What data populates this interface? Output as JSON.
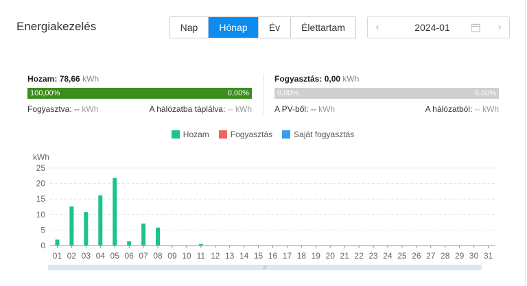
{
  "header": {
    "title": "Energiakezelés",
    "tabs": [
      {
        "label": "Nap",
        "active": false
      },
      {
        "label": "Hónap",
        "active": true
      },
      {
        "label": "Év",
        "active": false
      },
      {
        "label": "Élettartam",
        "active": false
      }
    ],
    "date_value": "2024-01"
  },
  "yield": {
    "label": "Hozam:",
    "value": "78,66",
    "unit": "kWh",
    "bar_left": "100,00%",
    "bar_right": "0,00%",
    "consumed_label": "Fogyasztva:",
    "consumed_value": "--",
    "consumed_unit": "kWh",
    "grid_label": "A hálózatba táplálva:",
    "grid_value": "--",
    "grid_unit": "kWh"
  },
  "consumption": {
    "label": "Fogyasztás:",
    "value": "0,00",
    "unit": "kWh",
    "bar_left": "0,00%",
    "bar_right": "0,00%",
    "pv_label": "A PV-ből:",
    "pv_value": "--",
    "pv_unit": "kWh",
    "grid_label": "A hálózatból:",
    "grid_value": "--",
    "grid_unit": "kWh"
  },
  "legend": [
    {
      "label": "Hozam",
      "color": "#1dc48a"
    },
    {
      "label": "Fogyasztás",
      "color": "#f0645a"
    },
    {
      "label": "Saját fogyasztás",
      "color": "#3c9af0"
    }
  ],
  "chart_data": {
    "type": "bar",
    "ylabel": "kWh",
    "ylim": [
      0,
      25
    ],
    "yticks": [
      0,
      5,
      10,
      15,
      20,
      25
    ],
    "categories": [
      "01",
      "02",
      "03",
      "04",
      "05",
      "06",
      "07",
      "08",
      "09",
      "10",
      "11",
      "12",
      "13",
      "14",
      "15",
      "16",
      "17",
      "18",
      "19",
      "20",
      "21",
      "22",
      "23",
      "24",
      "25",
      "26",
      "27",
      "28",
      "29",
      "30",
      "31"
    ],
    "series": [
      {
        "name": "Hozam",
        "color": "#1dc48a",
        "values": [
          1.9,
          12.6,
          10.8,
          16.2,
          21.8,
          1.4,
          7.1,
          5.8,
          0,
          0,
          0.5,
          0,
          0,
          0,
          0,
          0,
          0,
          0,
          0,
          0,
          0,
          0,
          0,
          0,
          0,
          0,
          0,
          0,
          0,
          0,
          0
        ]
      }
    ],
    "grid": true
  }
}
